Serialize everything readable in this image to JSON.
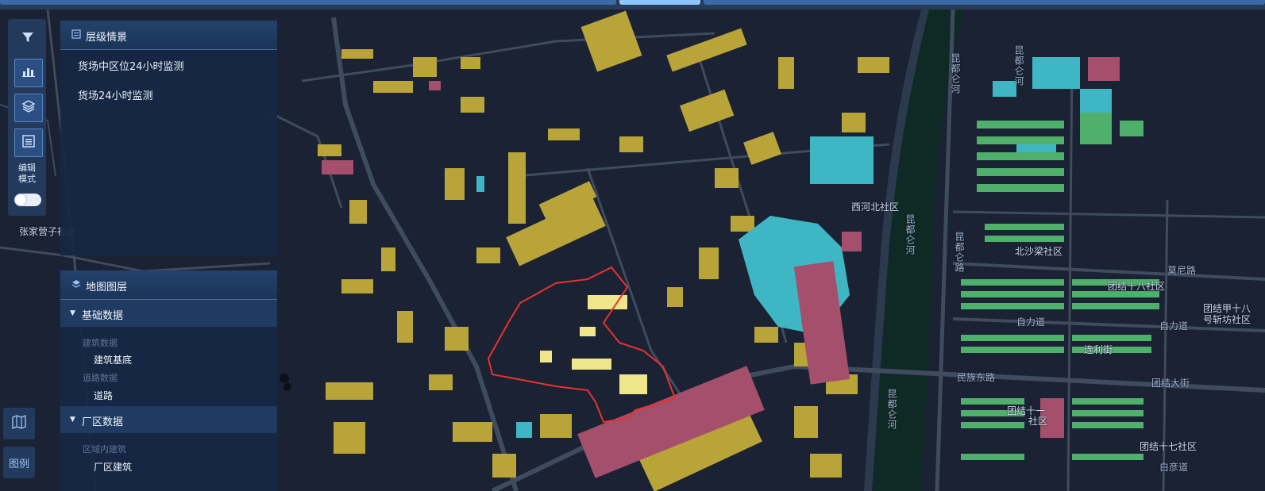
{
  "colors": {
    "background": "#1a2233",
    "industrial": "#b9a43a",
    "residential": "#4fb06b",
    "public": "#3fb6c3",
    "commercial": "#a44f6b",
    "road": "#3f4b5e",
    "river": "#0f2a25",
    "boundary": "#e8322e"
  },
  "rail": {
    "filter_icon": "filter-icon",
    "chart_icon": "bar-chart-icon",
    "layers_icon": "layers-icon",
    "list_icon": "list-icon",
    "edit_mode_line1": "编辑",
    "edit_mode_line2": "模式"
  },
  "level_panel": {
    "title": "层级情景",
    "items": [
      "货场中区位24小时监测",
      "货场24小时监测"
    ]
  },
  "layer_panel": {
    "title": "地图图层",
    "groups": [
      {
        "label": "基础数据",
        "categories": [
          {
            "label": "建筑数据",
            "leaf": "建筑基底"
          },
          {
            "label": "道路数据",
            "leaf": "道路"
          }
        ]
      },
      {
        "label": "厂区数据",
        "categories": [
          {
            "label": "区域内建筑",
            "leaf": "厂区建筑"
          }
        ]
      }
    ]
  },
  "corner": {
    "map_icon": "map-icon",
    "legend_label": "图例"
  },
  "map_labels": {
    "zhangjia": "张家营子社区",
    "xihe": "西河北社区",
    "beisha": "北沙梁社区",
    "tuanjie18": "团结十八社区",
    "tuanjiejia": "团结甲十八",
    "haofang": "号斩坊社区",
    "ziliwei": "自力道",
    "lianlijie": "连利街",
    "tuanjiedajie": "团结大街",
    "tuanjie17": "团结十七社区",
    "tuanjieshi": "团结十一",
    "zhongshequ": "社区",
    "bailian": "白彦道",
    "meinilu": "莫尼路",
    "kunduhe_top": "昆都仑河",
    "kunduhe_mid": "昆都仑河",
    "kunduhe_bottom": "昆都仑河",
    "kunduhe_right": "昆都仑河",
    "zijiang": "自力道",
    "minzu": "民族东路",
    "kundunlu": "昆都仑路"
  }
}
